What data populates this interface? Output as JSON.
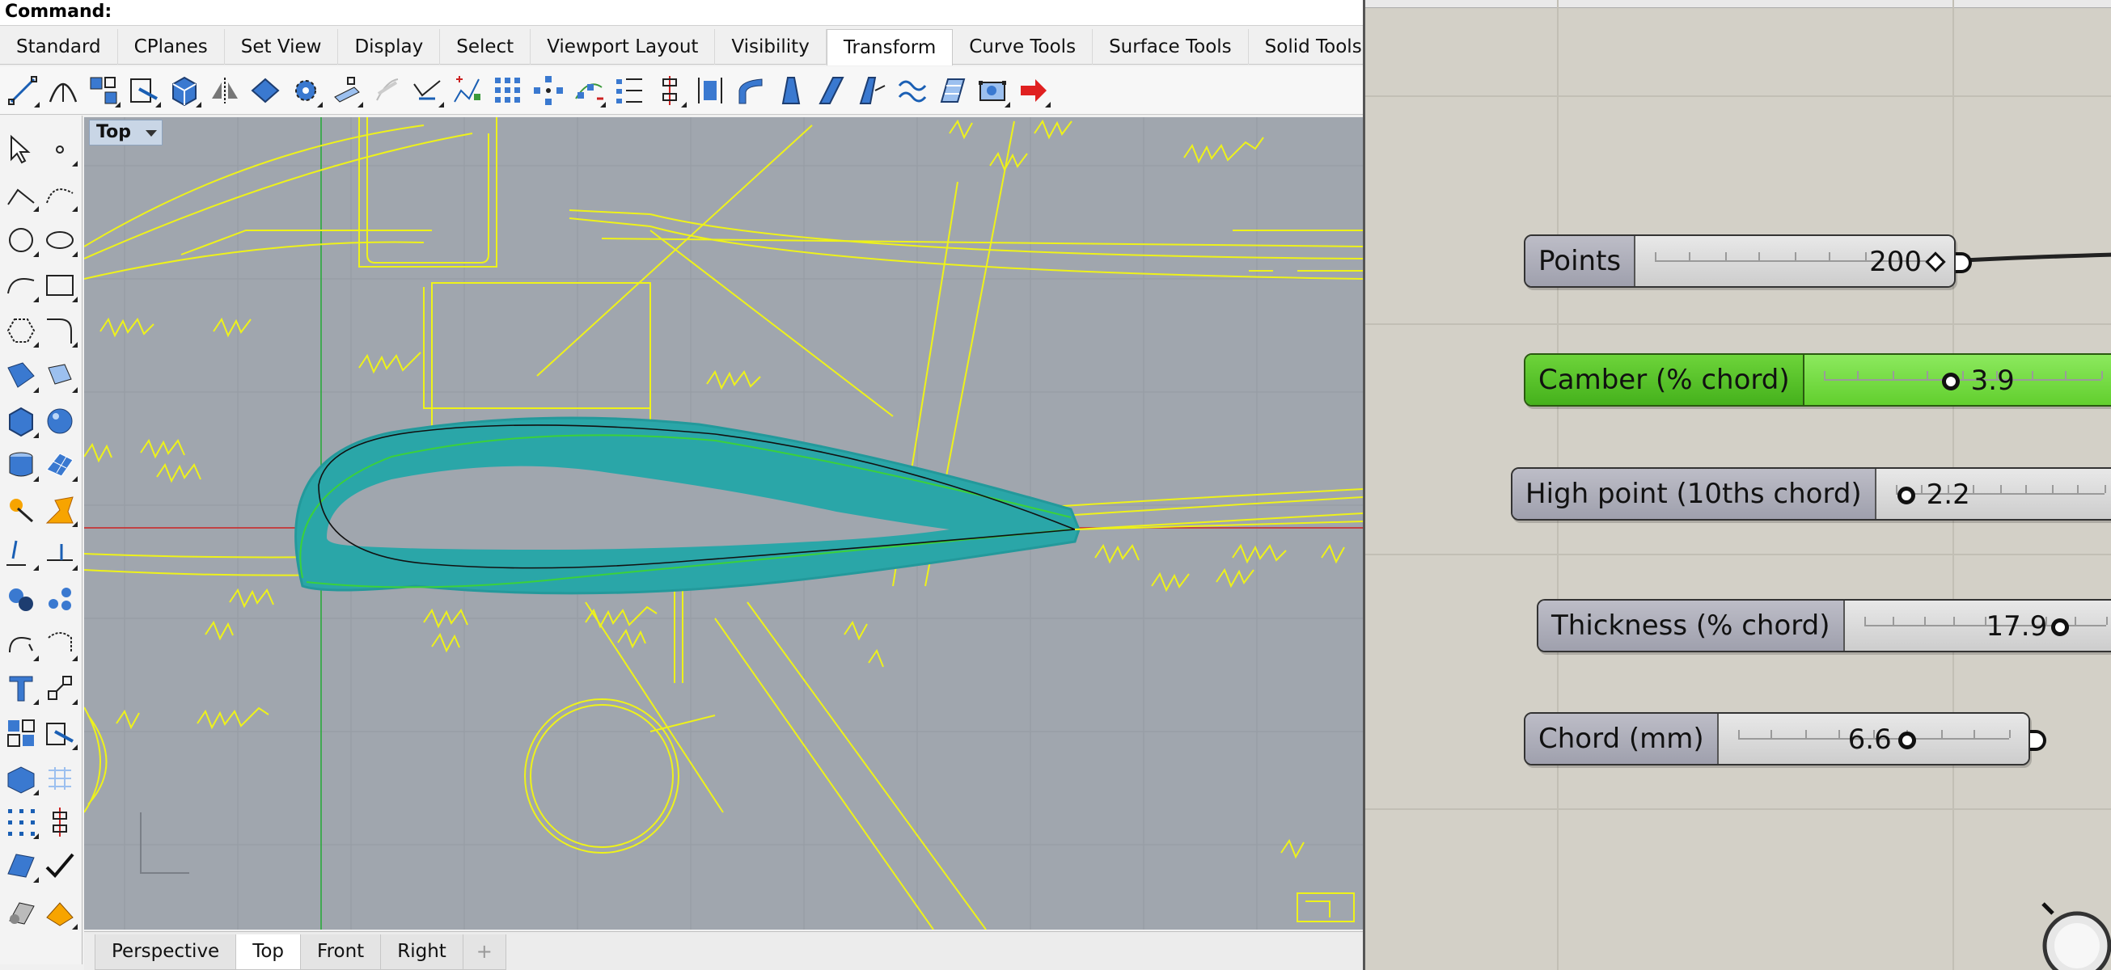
{
  "rhino": {
    "command_label": "Command:",
    "tabs": [
      {
        "label": "Standard",
        "active": false
      },
      {
        "label": "CPlanes",
        "active": false
      },
      {
        "label": "Set View",
        "active": false
      },
      {
        "label": "Display",
        "active": false
      },
      {
        "label": "Select",
        "active": false
      },
      {
        "label": "Viewport Layout",
        "active": false
      },
      {
        "label": "Visibility",
        "active": false
      },
      {
        "label": "Transform",
        "active": true
      },
      {
        "label": "Curve Tools",
        "active": false
      },
      {
        "label": "Surface Tools",
        "active": false
      },
      {
        "label": "Solid Tools",
        "active": false
      }
    ],
    "toolbar_icons": [
      "move-icon",
      "copy-icon",
      "rotate-icon",
      "scale-icon",
      "box-icon",
      "mirror-icon",
      "orient-icon",
      "array-icon",
      "array-polar-icon",
      "project-icon",
      "twist-icon",
      "bend-icon",
      "taper-icon",
      "flow-icon",
      "smash-icon",
      "arrow-icon"
    ],
    "viewport": {
      "title": "Top",
      "tabs": [
        {
          "label": "Perspective",
          "active": false
        },
        {
          "label": "Top",
          "active": true
        },
        {
          "label": "Front",
          "active": false
        },
        {
          "label": "Right",
          "active": false
        }
      ],
      "add_tab_symbol": "+"
    },
    "colors": {
      "sketch": "#eef21a",
      "airfoil_fill": "#2aa6a8",
      "grid_axis_x": "#cc2222",
      "grid_axis_y": "#22aa33"
    }
  },
  "grasshopper": {
    "sliders": [
      {
        "label": "Points",
        "value": "200",
        "style": "gray",
        "marker": "diamond"
      },
      {
        "label": "Camber (% chord)",
        "value": "3.9",
        "style": "green",
        "marker": "knob"
      },
      {
        "label": "High point (10ths chord)",
        "value": "2.2",
        "style": "gray",
        "marker": "knob"
      },
      {
        "label": "Thickness (% chord)",
        "value": "17.9",
        "style": "gray",
        "marker": "knob"
      },
      {
        "label": "Chord (mm)",
        "value": "6.6",
        "style": "gray",
        "marker": "knob"
      }
    ]
  }
}
